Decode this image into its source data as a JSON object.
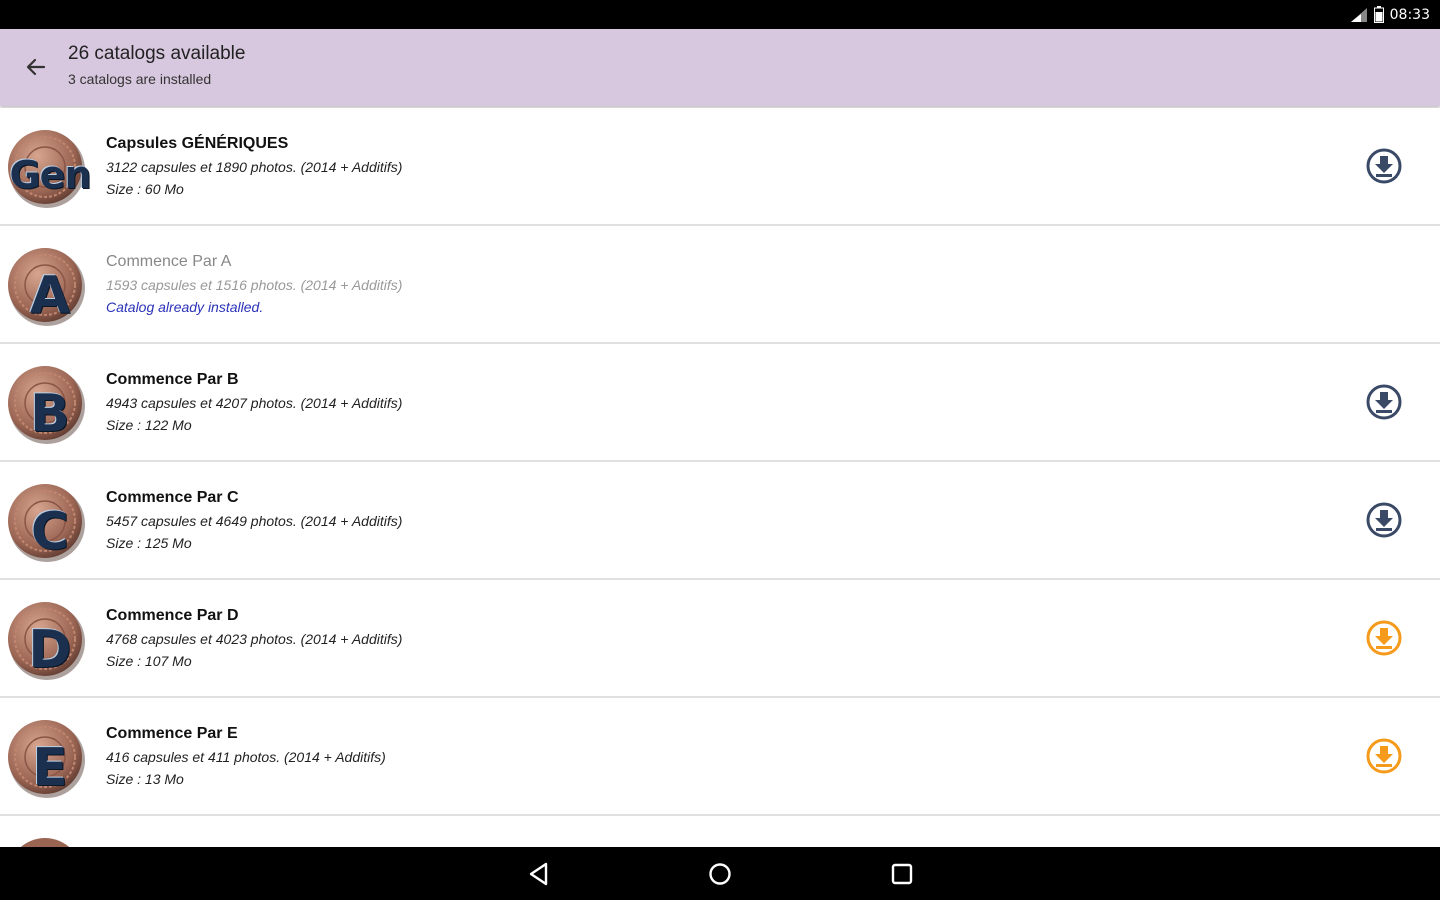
{
  "status_bar": {
    "time": "08:33",
    "icons": [
      "signal-icon",
      "battery-icon"
    ]
  },
  "app_bar": {
    "title": "26 catalogs available",
    "subtitle": "3 catalogs are installed"
  },
  "colors": {
    "app_bar_bg": "#d8c8df",
    "download_default": "#3a4a66",
    "download_highlight": "#f59a1b",
    "installed_status": "#2a32b8"
  },
  "catalogs": [
    {
      "badge": "Gen",
      "title": "Capsules GÉNÉRIQUES",
      "description": "3122 capsules et 1890 photos. (2014 + Additifs)",
      "status": "Size : 60 Mo",
      "installed": false,
      "download_color": "#3a4a66"
    },
    {
      "badge": "A",
      "title": "Commence Par A",
      "description": "1593 capsules et 1516 photos. (2014 + Additifs)",
      "status": "Catalog already installed.",
      "installed": true
    },
    {
      "badge": "B",
      "title": "Commence Par B",
      "description": "4943 capsules et 4207 photos. (2014 + Additifs)",
      "status": "Size : 122 Mo",
      "installed": false,
      "download_color": "#3a4a66"
    },
    {
      "badge": "C",
      "title": "Commence Par C",
      "description": "5457 capsules et 4649 photos. (2014 + Additifs)",
      "status": "Size : 125 Mo",
      "installed": false,
      "download_color": "#3a4a66"
    },
    {
      "badge": "D",
      "title": "Commence Par D",
      "description": "4768 capsules et 4023 photos. (2014 + Additifs)",
      "status": "Size : 107 Mo",
      "installed": false,
      "download_color": "#f59a1b"
    },
    {
      "badge": "E",
      "title": "Commence Par E",
      "description": "416 capsules et 411 photos. (2014 + Additifs)",
      "status": "Size : 13 Mo",
      "installed": false,
      "download_color": "#f59a1b"
    }
  ],
  "nav_bar": {
    "buttons": [
      "back-nav-icon",
      "home-nav-icon",
      "recents-nav-icon"
    ]
  }
}
